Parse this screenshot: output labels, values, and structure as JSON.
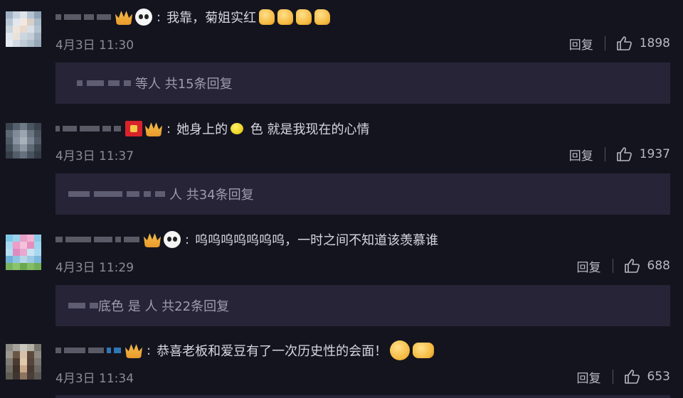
{
  "comments": [
    {
      "text": "我靠，菊姐实红",
      "emojis": [
        "thumbs-up",
        "thumbs-up",
        "thumbs-up",
        "thumbs-up"
      ],
      "badges": [
        "crown-badge",
        "panda-badge"
      ],
      "date": "4月3日 11:30",
      "reply_label": "回复",
      "likes": "1898",
      "replies_summary": "等人 共15条回复"
    },
    {
      "text_before_emoji": "她身上的",
      "emoji": "lemon",
      "text_after_emoji": " 色 就是我现在的心情",
      "badges": [
        "red-envelope-badge",
        "crown-badge"
      ],
      "date": "4月3日 11:37",
      "reply_label": "回复",
      "likes": "1937",
      "replies_summary": "人 共34条回复"
    },
    {
      "text": "呜呜呜呜呜呜呜，一时之间不知道该羡慕谁",
      "badges": [
        "crown-badge",
        "panda-badge"
      ],
      "date": "4月3日 11:29",
      "reply_label": "回复",
      "likes": "688",
      "replies_summary": "底色 是 人 共22条回复"
    },
    {
      "text": "恭喜老板和爱豆有了一次历史性的会面！",
      "emojis": [
        "blushing-face",
        "handshake"
      ],
      "badges": [
        "crown-badge"
      ],
      "date": "4月3日 11:34",
      "reply_label": "回复",
      "likes": "653"
    }
  ],
  "colors": {
    "background": "#14141f",
    "reply_box": "#272438",
    "meta_text": "#8c8b99",
    "body_text": "#d7d6df"
  }
}
